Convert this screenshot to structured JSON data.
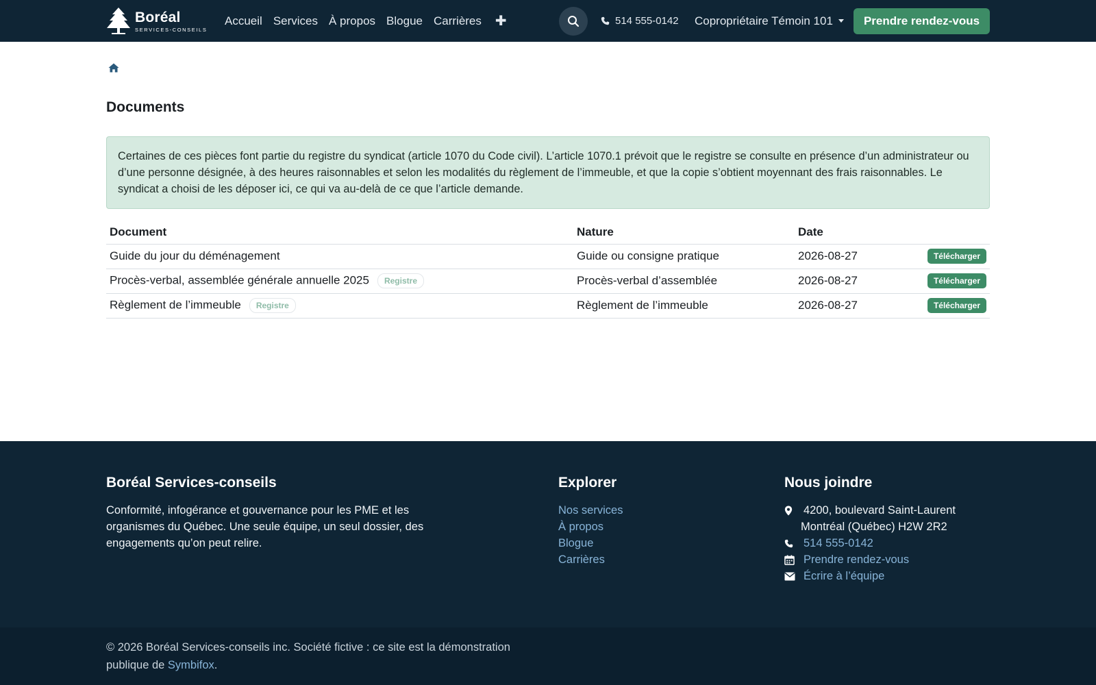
{
  "header": {
    "brand": {
      "name": "Boréal",
      "tagline": "SERVICES-CONSEILS"
    },
    "nav": [
      {
        "label": "Accueil"
      },
      {
        "label": "Services"
      },
      {
        "label": "À propos"
      },
      {
        "label": "Blogue"
      },
      {
        "label": "Carrières"
      }
    ],
    "more_label": "✚",
    "phone": "514 555-0142",
    "user": "Copropriétaire Témoin 101",
    "cta": "Prendre rendez-vous"
  },
  "colors": {
    "navbar_bg": "#0f2535",
    "accent_green": "#3d8c66",
    "notice_bg": "#d6eae0",
    "link": "#88b4d8"
  },
  "main": {
    "title": "Documents",
    "notice": "Certaines de ces pièces font partie du registre du syndicat (article 1070 du Code civil). L’article 1070.1 prévoit que le registre se consulte en présence d’un administrateur ou d’une personne désignée, à des heures raisonnables et selon les modalités du règlement de l’immeuble, et que la copie s’obtient moyennant des frais raisonnables. Le syndicat a choisi de les déposer ici, ce qui va au-delà de ce que l’article demande.",
    "table": {
      "headers": [
        "Document",
        "Nature",
        "Date"
      ],
      "rows": [
        {
          "document": "Guide du jour du déménagement",
          "tag": "",
          "nature": "Guide ou consigne pratique",
          "date": "2026-08-27",
          "action": "Télécharger"
        },
        {
          "document": "Procès-verbal, assemblée générale annuelle 2025",
          "tag": "Registre",
          "nature": "Procès-verbal d’assemblée",
          "date": "2026-08-27",
          "action": "Télécharger"
        },
        {
          "document": "Règlement de l’immeuble",
          "tag": "Registre",
          "nature": "Règlement de l’immeuble",
          "date": "2026-08-27",
          "action": "Télécharger"
        }
      ]
    }
  },
  "footer": {
    "about_title": "Boréal Services-conseils",
    "about_text": "Conformité, infogérance et gouvernance pour les PME et les organismes du Québec. Une seule équipe, un seul dossier, des engagements qu’on peut relire.",
    "explore_title": "Explorer",
    "explore_links": [
      "Nos services",
      "À propos",
      "Blogue",
      "Carrières"
    ],
    "contact_title": "Nous joindre",
    "address_line1": "4200, boulevard Saint-Laurent",
    "address_line2": "Montréal (Québec) H2W 2R2",
    "phone": "514 555-0142",
    "appointment": "Prendre rendez-vous",
    "email": "Écrire à l’équipe",
    "copyright": "© 2026 Boréal Services-conseils inc. Société fictive : ce site est la démonstration publique de ",
    "copyright_link": "Symbifox",
    "copyright_end": "."
  }
}
